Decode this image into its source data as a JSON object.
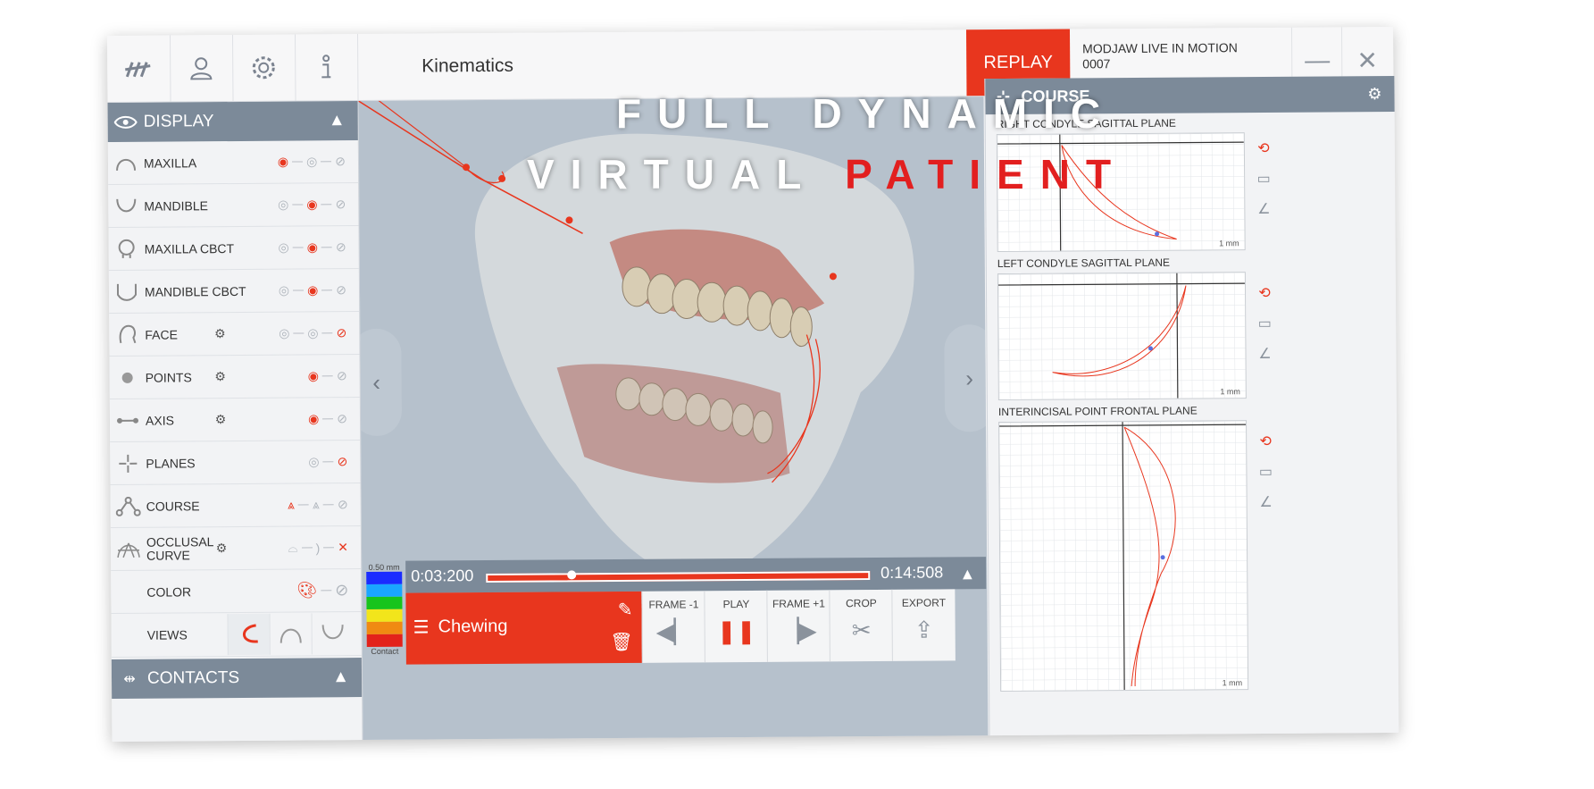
{
  "app": {
    "title": "Kinematics",
    "replay_label": "REPLAY",
    "project_line1": "MODJAW LIVE IN MOTION",
    "project_line2": "0007",
    "minimize_symbol": "—",
    "close_symbol": "✕"
  },
  "toolbar_icons": [
    "modjaw-logo-icon",
    "user-icon",
    "gear-icon",
    "info-icon"
  ],
  "display_panel": {
    "header": "DISPLAY",
    "rows": [
      {
        "label": "MAXILLA",
        "icon": "maxilla-icon"
      },
      {
        "label": "MANDIBLE",
        "icon": "mandible-icon"
      },
      {
        "label": "MAXILLA CBCT",
        "icon": "skull-icon"
      },
      {
        "label": "MANDIBLE CBCT",
        "icon": "mandible-cbct-icon"
      },
      {
        "label": "FACE",
        "icon": "face-icon"
      },
      {
        "label": "POINTS",
        "icon": "points-icon"
      },
      {
        "label": "AXIS",
        "icon": "axis-icon"
      },
      {
        "label": "PLANES",
        "icon": "planes-icon"
      },
      {
        "label": "COURSE",
        "icon": "course-icon"
      },
      {
        "label": "OCCLUSAL CURVE",
        "icon": "occlusal-curve-icon"
      },
      {
        "label": "COLOR",
        "icon": ""
      },
      {
        "label": "VIEWS",
        "icon": ""
      }
    ]
  },
  "contacts_panel": {
    "header": "CONTACTS"
  },
  "timeline": {
    "current": "0:03:200",
    "total": "0:14:508",
    "progress": 0.22
  },
  "color_scale": {
    "top_label": "0.50 mm",
    "bottom_label": "Contact",
    "colors": [
      "#1a2cff",
      "#1aa6ff",
      "#17c41c",
      "#f2e51b",
      "#f08a12",
      "#e3221b"
    ]
  },
  "motion": {
    "name": "Chewing"
  },
  "controls": [
    {
      "label": "FRAME -1",
      "symbol": "◀▏"
    },
    {
      "label": "PLAY",
      "symbol": "❚❚"
    },
    {
      "label": "FRAME +1",
      "symbol": "▕▶"
    },
    {
      "label": "CROP",
      "symbol": "✂"
    },
    {
      "label": "EXPORT",
      "symbol": "⇪"
    }
  ],
  "course_panel": {
    "header": "COURSE",
    "plots": [
      {
        "title": "RIGHT CONDYLE SAGITTAL PLANE",
        "scale": "1 mm"
      },
      {
        "title": "LEFT CONDYLE SAGITTAL PLANE",
        "scale": "1 mm"
      },
      {
        "title": "INTERINCISAL POINT FRONTAL PLANE",
        "scale": "1 mm"
      }
    ]
  },
  "overlay": {
    "line1": "FULL DYNAMIC",
    "line2a": "VIRTUAL",
    "line2b": "PATIENT"
  },
  "colors": {
    "accent": "#e8361e",
    "panel_header": "#7c8a99"
  }
}
